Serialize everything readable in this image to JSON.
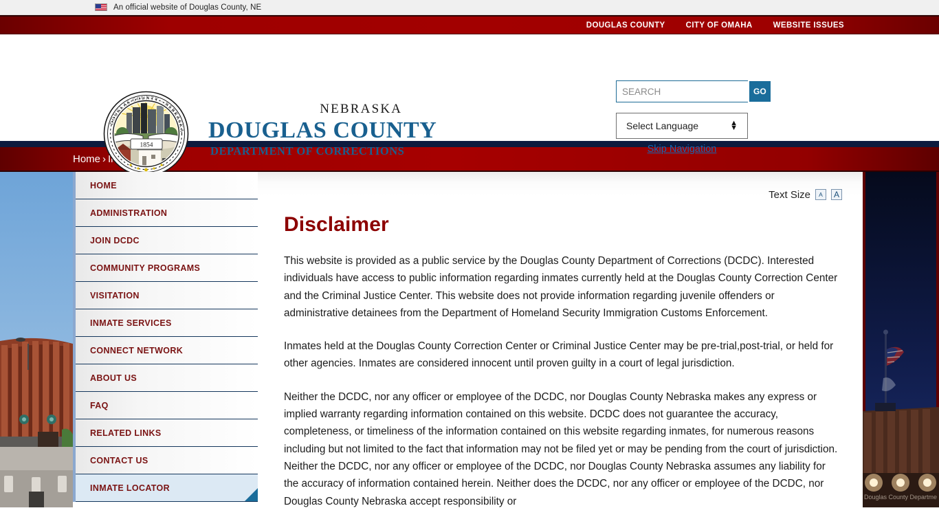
{
  "gov_banner": {
    "icon": "us-flag-icon",
    "text": "An official website of Douglas County, NE"
  },
  "top_nav": {
    "links": [
      {
        "label": "DOUGLAS COUNTY"
      },
      {
        "label": "CITY OF OMAHA"
      },
      {
        "label": "WEBSITE ISSUES"
      }
    ]
  },
  "masthead": {
    "seal_icon": "douglas-county-seal",
    "seal_year": "1854",
    "line1": "NEBRASKA",
    "line2": "DOUGLAS COUNTY",
    "line3": "DEPARTMENT OF CORRECTIONS"
  },
  "search": {
    "value": "",
    "placeholder": "SEARCH",
    "go_label": "GO"
  },
  "language": {
    "selected": "Select Language",
    "icon": "updown-arrows-icon"
  },
  "skip_navigation": "Skip Navigation",
  "breadcrumb": {
    "home": "Home",
    "separator": "›",
    "current": "Inmate Locator"
  },
  "sidebar": {
    "items": [
      {
        "label": "HOME",
        "active": false
      },
      {
        "label": "ADMINISTRATION",
        "active": false
      },
      {
        "label": "JOIN DCDC",
        "active": false
      },
      {
        "label": "COMMUNITY PROGRAMS",
        "active": false
      },
      {
        "label": "VISITATION",
        "active": false
      },
      {
        "label": "INMATE SERVICES",
        "active": false
      },
      {
        "label": "CONNECT NETWORK",
        "active": false
      },
      {
        "label": "ABOUT US",
        "active": false
      },
      {
        "label": "FAQ",
        "active": false
      },
      {
        "label": "RELATED LINKS",
        "active": false
      },
      {
        "label": "CONTACT US",
        "active": false
      },
      {
        "label": "INMATE LOCATOR",
        "active": true
      }
    ]
  },
  "text_size": {
    "label": "Text Size",
    "small_label": "A",
    "large_label": "A"
  },
  "main": {
    "title": "Disclaimer",
    "paragraphs": [
      "This website is provided as a public service by the Douglas County Department of Corrections (DCDC). Interested individuals have access to public information regarding inmates currently held at the Douglas County Correction Center and the Criminal Justice Center. This website does not provide information regarding juvenile offenders or administrative detainees from the Department of Homeland Security Immigration Customs Enforcement.",
      "Inmates held at the Douglas County Correction Center or Criminal Justice Center may be pre-trial,post-trial, or held for other agencies. Inmates are considered innocent until proven guilty in a court of legal jurisdiction.",
      "Neither the DCDC, nor any officer or employee of the DCDC, nor Douglas County Nebraska makes any express or implied warranty regarding information contained on this website. DCDC does not guarantee the accuracy, completeness, or timeliness of the information contained on this website regarding inmates, for numerous reasons including but not limited to the fact that information may not be filed yet or may be pending from the court of jurisdiction. Neither the DCDC, nor any officer or employee of the DCDC, nor Douglas County Nebraska assumes any liability for the accuracy of information contained herein. Neither does the DCDC, nor any officer or employee of the DCDC, nor Douglas County Nebraska accept responsibility or"
    ]
  },
  "background": {
    "left_image": "brick-building-daytime-photo",
    "right_image": "flagpole-night-photo",
    "right_watermark": "Douglas County Department"
  },
  "colors": {
    "nav_red": "#a20000",
    "brand_blue": "#19608f",
    "title_maroon": "#8c0000",
    "accent_blue": "#1a6d9b",
    "sidebar_text": "#7a1313"
  }
}
